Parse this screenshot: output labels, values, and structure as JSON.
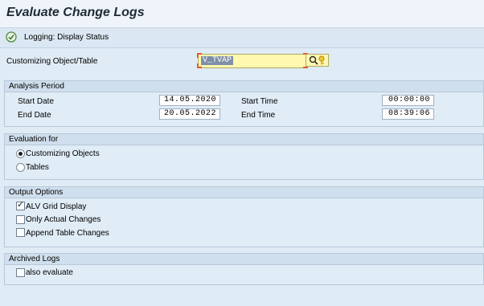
{
  "window": {
    "title": "Evaluate Change Logs"
  },
  "toolbar": {
    "logging_label": "Logging: Display Status",
    "logging_icon": "logging-status-icon"
  },
  "customizing": {
    "label": "Customizing Object/Table",
    "value": "V_TVAP"
  },
  "analysis_period": {
    "title": "Analysis Period",
    "start_date_label": "Start Date",
    "start_date": "14.05.2020",
    "end_date_label": "End Date",
    "end_date": "20.05.2022",
    "start_time_label": "Start Time",
    "start_time": "00:00:00",
    "end_time_label": "End Time",
    "end_time": "08:39:06"
  },
  "evaluation_for": {
    "title": "Evaluation for",
    "options": [
      {
        "label": "Customizing Objects",
        "selected": true
      },
      {
        "label": "Tables",
        "selected": false
      }
    ]
  },
  "output_options": {
    "title": "Output Options",
    "options": [
      {
        "label": "ALV Grid Display",
        "checked": true
      },
      {
        "label": "Only Actual Changes",
        "checked": false
      },
      {
        "label": "Append Table Changes",
        "checked": false
      }
    ]
  },
  "archived_logs": {
    "title": "Archived Logs",
    "also_evaluate_label": "also evaluate",
    "also_evaluate_checked": false
  }
}
